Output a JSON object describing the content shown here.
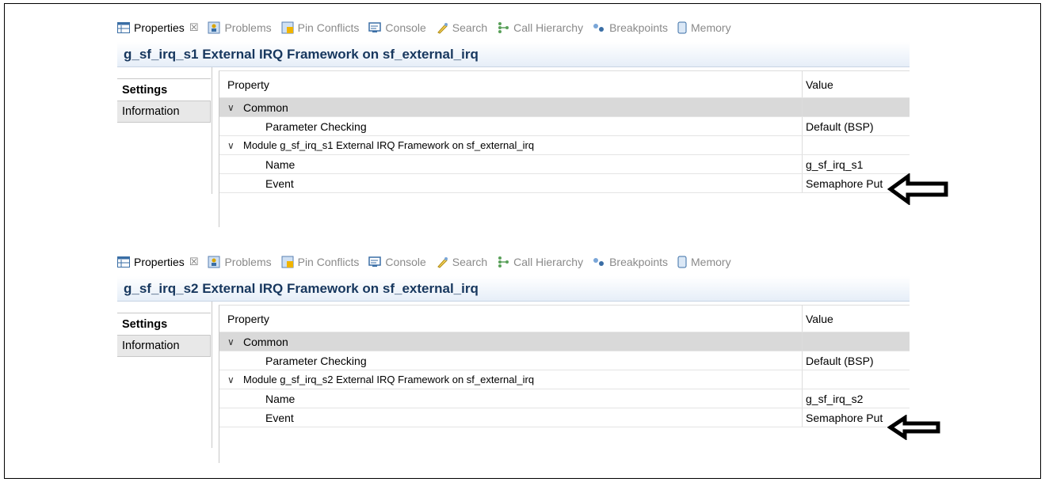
{
  "panels": [
    {
      "tabs": [
        {
          "label": "Properties",
          "icon": "properties-icon",
          "active": true,
          "close": "☒"
        },
        {
          "label": "Problems",
          "icon": "problems-icon"
        },
        {
          "label": "Pin Conflicts",
          "icon": "pin-conflicts-icon"
        },
        {
          "label": "Console",
          "icon": "console-icon"
        },
        {
          "label": "Search",
          "icon": "search-icon"
        },
        {
          "label": "Call Hierarchy",
          "icon": "call-hierarchy-icon"
        },
        {
          "label": "Breakpoints",
          "icon": "breakpoints-icon"
        },
        {
          "label": "Memory",
          "icon": "memory-icon"
        }
      ],
      "title": "g_sf_irq_s1 External IRQ Framework on sf_external_irq",
      "side_tabs": [
        "Settings",
        "Information"
      ],
      "columns": [
        "Property",
        "Value"
      ],
      "rows": [
        {
          "property": "Common",
          "value": ""
        },
        {
          "property": "Parameter Checking",
          "value": "Default (BSP)"
        },
        {
          "property": "Module g_sf_irq_s1 External IRQ Framework on sf_external_irq",
          "value": ""
        },
        {
          "property": "Name",
          "value": "g_sf_irq_s1"
        },
        {
          "property": "Event",
          "value": "Semaphore Put"
        }
      ]
    },
    {
      "tabs": [
        {
          "label": "Properties",
          "icon": "properties-icon",
          "active": true,
          "close": "☒"
        },
        {
          "label": "Problems",
          "icon": "problems-icon"
        },
        {
          "label": "Pin Conflicts",
          "icon": "pin-conflicts-icon"
        },
        {
          "label": "Console",
          "icon": "console-icon"
        },
        {
          "label": "Search",
          "icon": "search-icon"
        },
        {
          "label": "Call Hierarchy",
          "icon": "call-hierarchy-icon"
        },
        {
          "label": "Breakpoints",
          "icon": "breakpoints-icon"
        },
        {
          "label": "Memory",
          "icon": "memory-icon"
        }
      ],
      "title": "g_sf_irq_s2 External IRQ Framework on sf_external_irq",
      "side_tabs": [
        "Settings",
        "Information"
      ],
      "columns": [
        "Property",
        "Value"
      ],
      "rows": [
        {
          "property": "Common",
          "value": ""
        },
        {
          "property": "Parameter Checking",
          "value": "Default (BSP)"
        },
        {
          "property": "Module g_sf_irq_s2 External IRQ Framework on sf_external_irq",
          "value": ""
        },
        {
          "property": "Name",
          "value": "g_sf_irq_s2"
        },
        {
          "property": "Event",
          "value": "Semaphore Put"
        }
      ]
    }
  ],
  "colors": {
    "title": "#17375e",
    "header_grey": "#d9d9d9",
    "side_tab_grey": "#e8e8e8"
  }
}
